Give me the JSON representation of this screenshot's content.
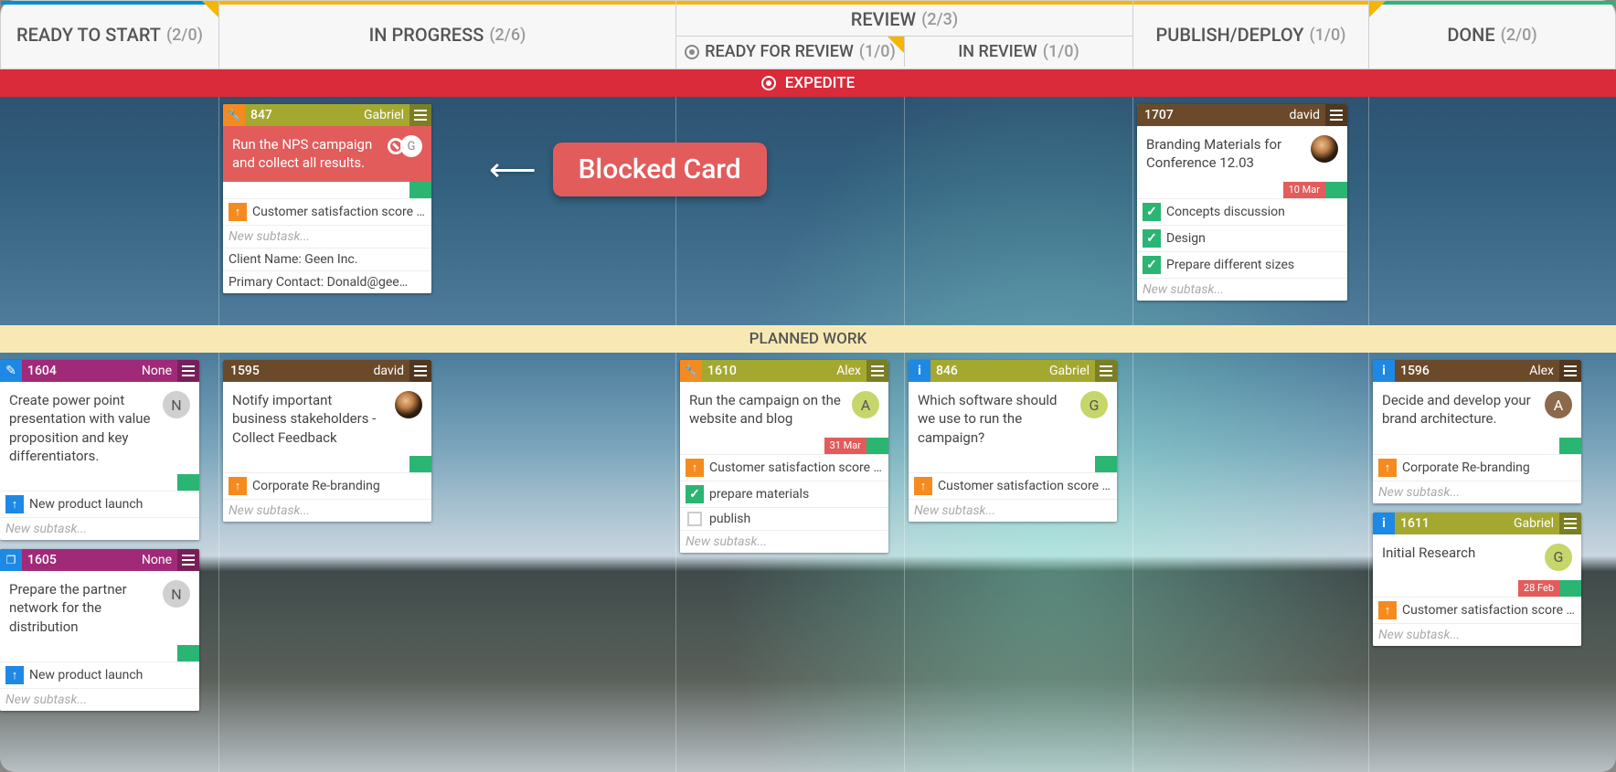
{
  "columns": {
    "ready": {
      "title": "READY TO START",
      "wip": "(2/0)"
    },
    "progress": {
      "title": "IN PROGRESS",
      "wip": "(2/6)"
    },
    "review": {
      "title": "REVIEW",
      "wip": "(2/3)",
      "sub": {
        "readyrev": {
          "title": "READY FOR REVIEW",
          "wip": "(1/0)"
        },
        "inreview": {
          "title": "IN REVIEW",
          "wip": "(1/0)"
        }
      }
    },
    "publish": {
      "title": "PUBLISH/DEPLOY",
      "wip": "(1/0)"
    },
    "done": {
      "title": "DONE",
      "wip": "(2/0)"
    }
  },
  "lanes": {
    "expedite": "EXPEDITE",
    "planned": "PLANNED WORK"
  },
  "callout": "Blocked Card",
  "common": {
    "new_subtask": "New subtask..."
  },
  "cards": {
    "c847": {
      "id": "847",
      "assignee": "Gabriel",
      "title": "Run the NPS campaign and collect all results.",
      "parent": "Customer satisfaction score c…",
      "info1": "Client Name: Geen Inc.",
      "info2": "Primary Contact: Donald@gee…"
    },
    "c1707": {
      "id": "1707",
      "assignee": "david",
      "title": "Branding Materials for Conference 12.03",
      "date": "10 Mar",
      "sub1": "Concepts discussion",
      "sub2": "Design",
      "sub3": "Prepare different sizes"
    },
    "c1604": {
      "id": "1604",
      "assignee": "None",
      "title": "Create power point presentation with value proposition and key differentiators.",
      "parent": "New product launch",
      "avatar": "N"
    },
    "c1605": {
      "id": "1605",
      "assignee": "None",
      "title": "Prepare the partner network for the distribution",
      "parent": "New product launch",
      "avatar": "N"
    },
    "c1595": {
      "id": "1595",
      "assignee": "david",
      "title": "Notify important business stakeholders - Collect Feedback",
      "parent": "Corporate Re-branding"
    },
    "c1610": {
      "id": "1610",
      "assignee": "Alex",
      "title": "Run the campaign on the website and blog",
      "avatar": "A",
      "date": "31 Mar",
      "parent": "Customer satisfaction score c…",
      "sub1": "prepare materials",
      "sub2": "publish"
    },
    "c846": {
      "id": "846",
      "assignee": "Gabriel",
      "title": "Which software should we use to run the campaign?",
      "avatar": "G",
      "parent": "Customer satisfaction score c…"
    },
    "c1596": {
      "id": "1596",
      "assignee": "Alex",
      "title": "Decide and develop your brand architecture.",
      "avatar": "A",
      "parent": "Corporate Re-branding"
    },
    "c1611": {
      "id": "1611",
      "assignee": "Gabriel",
      "title": "Initial Research",
      "avatar": "G",
      "date": "28 Feb",
      "parent": "Customer satisfaction score c…"
    }
  }
}
